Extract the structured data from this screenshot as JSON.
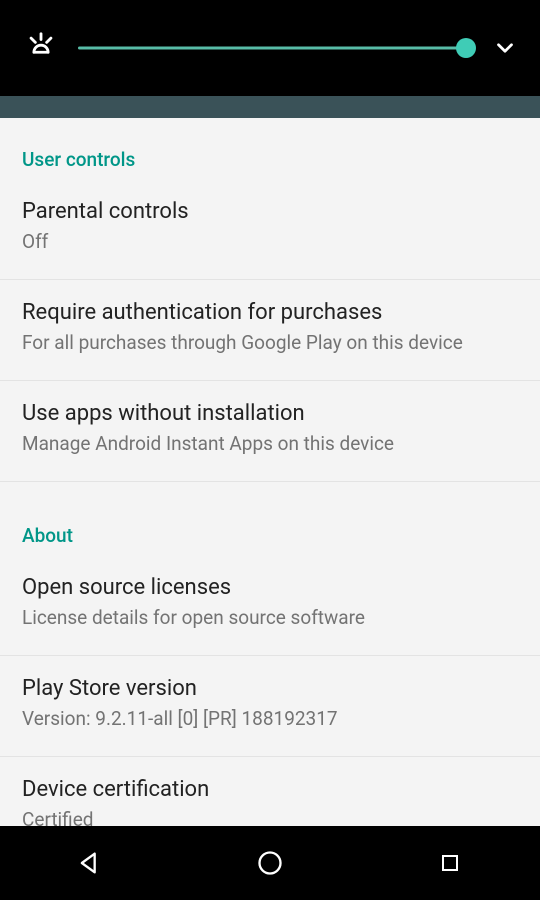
{
  "sections": {
    "user_controls": {
      "header": "User controls",
      "items": [
        {
          "title": "Parental controls",
          "sub": "Off"
        },
        {
          "title": "Require authentication for purchases",
          "sub": "For all purchases through Google Play on this device"
        },
        {
          "title": "Use apps without installation",
          "sub": "Manage Android Instant Apps on this device"
        }
      ]
    },
    "about": {
      "header": "About",
      "items": [
        {
          "title": "Open source licenses",
          "sub": "License details for open source software"
        },
        {
          "title": "Play Store version",
          "sub": "Version: 9.2.11-all [0] [PR] 188192317"
        },
        {
          "title": "Device certification",
          "sub": "Certified"
        }
      ]
    }
  },
  "volume": {
    "percent": 100
  }
}
